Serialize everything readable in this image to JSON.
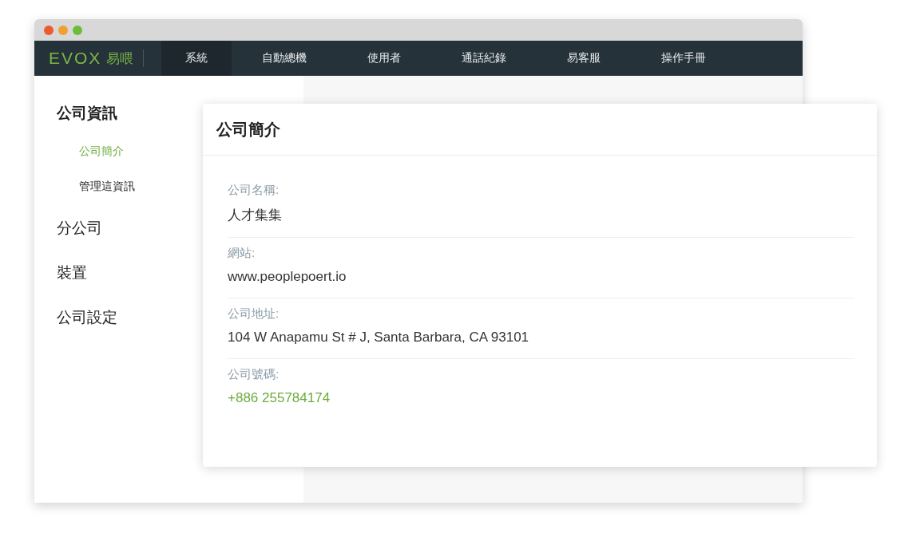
{
  "logo": {
    "mark": "EVOX",
    "name": "易喂"
  },
  "nav": [
    {
      "label": "系統",
      "selected": true
    },
    {
      "label": "自動總機",
      "selected": false
    },
    {
      "label": "使用者",
      "selected": false
    },
    {
      "label": "通話紀錄",
      "selected": false
    },
    {
      "label": "易客服",
      "selected": false
    },
    {
      "label": "操作手冊",
      "selected": false
    }
  ],
  "sidebar": {
    "items": [
      {
        "label": "公司資訊",
        "selected": false,
        "children": [
          {
            "label": "公司簡介",
            "selected": true
          },
          {
            "label": "管理這資訊",
            "selected": false
          }
        ]
      },
      {
        "label": "分公司",
        "selected": false
      },
      {
        "label": "裝置",
        "selected": false
      },
      {
        "label": "公司設定",
        "selected": false
      }
    ]
  },
  "card": {
    "title": "公司簡介",
    "fields": [
      {
        "label": "公司名稱:",
        "value": "人才集集",
        "kind": "text"
      },
      {
        "label": "網站:",
        "value": "www.peoplepoert.io",
        "kind": "text"
      },
      {
        "label": "公司地址:",
        "value": "104 W Anapamu St # J, Santa Barbara, CA 93101",
        "kind": "text"
      },
      {
        "label": "公司號碼:",
        "value": "+886 255784174",
        "kind": "phone"
      }
    ]
  }
}
